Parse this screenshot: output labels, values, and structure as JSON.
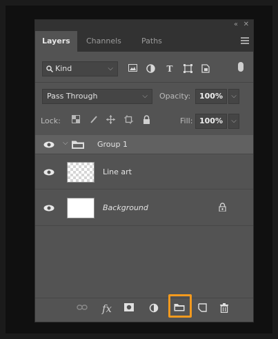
{
  "panel": {
    "tabs": [
      {
        "label": "Layers",
        "active": true
      },
      {
        "label": "Channels",
        "active": false
      },
      {
        "label": "Paths",
        "active": false
      }
    ],
    "collapse_glyph": "«",
    "close_glyph": "✕",
    "menu_icon": "hamburger-menu-icon"
  },
  "filter": {
    "kind_label": "Kind",
    "kind_icon": "search-icon",
    "filter_icons": [
      "image-filter-icon",
      "adjustment-filter-icon",
      "type-filter-icon",
      "shape-filter-icon",
      "smart-object-filter-icon"
    ],
    "type_glyph": "T"
  },
  "blend": {
    "mode": "Pass Through",
    "opacity_label": "Opacity:",
    "opacity_value": "100%"
  },
  "lock": {
    "label": "Lock:",
    "icons": [
      "lock-transparent-pixels-icon",
      "lock-image-pixels-icon",
      "lock-position-icon",
      "lock-artboard-icon",
      "lock-all-icon"
    ],
    "fill_label": "Fill:",
    "fill_value": "100%"
  },
  "layers": [
    {
      "name": "Group 1",
      "type": "group",
      "visible": true,
      "selected": true
    },
    {
      "name": "Line art",
      "type": "pixel",
      "visible": true
    },
    {
      "name": "Background",
      "type": "background",
      "visible": true,
      "locked": true
    }
  ],
  "bottom_icons": [
    "link-layers-icon",
    "fx-icon",
    "add-mask-icon",
    "adjustment-layer-icon",
    "new-group-folder-icon",
    "new-layer-icon",
    "trash-icon"
  ],
  "fx_label": "fx",
  "highlight_color": "#f39a1e"
}
